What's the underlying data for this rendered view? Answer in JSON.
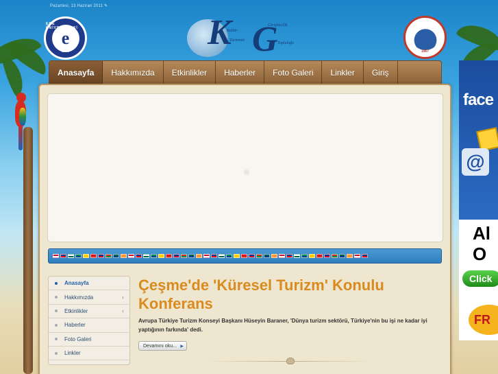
{
  "header": {
    "date_text": "Pazartesi, 13 Haziran 2011",
    "left_logo": {
      "ring_text": "EGE ÜNİVERSİTESİ",
      "letter": "e",
      "year": "1955"
    },
    "center_logo": {
      "letters": [
        "K",
        "G"
      ],
      "words": [
        "Kültür",
        "Turizmde",
        "Girişimcilik",
        "Topluluğu"
      ]
    },
    "right_logo": {
      "year": "1967"
    }
  },
  "nav": {
    "items": [
      {
        "label": "Anasayfa",
        "active": true
      },
      {
        "label": "Hakkımızda"
      },
      {
        "label": "Etkinlikler"
      },
      {
        "label": "Haberler"
      },
      {
        "label": "Foto Galeri"
      },
      {
        "label": "Linkler"
      },
      {
        "label": "Giriş"
      }
    ]
  },
  "language_flags": [
    "en",
    "ar",
    "bg",
    "zh",
    "zh-tw",
    "hr",
    "cs",
    "da",
    "nl",
    "fi",
    "fr",
    "de",
    "el",
    "hi",
    "it",
    "ja",
    "ko",
    "no",
    "pl",
    "pt",
    "ro",
    "ru",
    "es",
    "sv",
    "ca",
    "tl",
    "iw",
    "id",
    "lv",
    "lt",
    "sr",
    "sk",
    "sl",
    "uk",
    "vi",
    "sq",
    "et",
    "gl",
    "hu",
    "mt",
    "th",
    "tr"
  ],
  "left_menu": {
    "items": [
      {
        "label": "Anasayfa",
        "active": true
      },
      {
        "label": "Hakkımızda",
        "has_children": true
      },
      {
        "label": "Etkinlikler",
        "has_children": true
      },
      {
        "label": "Haberler"
      },
      {
        "label": "Foto Galeri"
      },
      {
        "label": "Linkler"
      }
    ]
  },
  "article": {
    "title": "Çeşme'de 'Küresel Turizm' Konulu Konferans",
    "body": "Avrupa Türkiye Turizm Konseyi Başkanı Hüseyin Baraner, 'Dünya turizm sektörü, Türkiye'nin bu işi ne kadar iyi yaptığının farkında' dedi.",
    "read_more": "Devamını oku..."
  },
  "ad": {
    "brand": "face",
    "headline": "Al O",
    "button": "Click",
    "badge": "FR"
  },
  "colors": {
    "nav_brown": "#8c6238",
    "title_orange": "#d98b1f",
    "lang_bar_blue": "#2f7fbf"
  }
}
